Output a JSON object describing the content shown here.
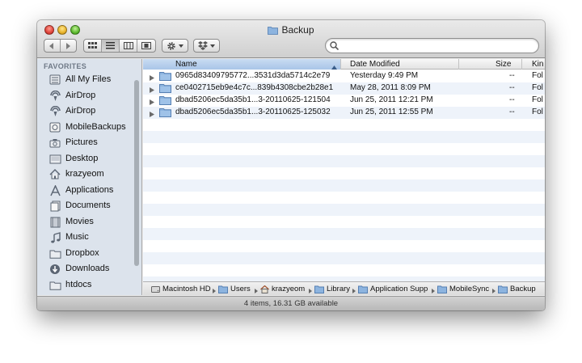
{
  "window": {
    "title": "Backup",
    "status": "4 items, 16.31 GB available"
  },
  "toolbar": {
    "back_icon": "back-arrow-icon",
    "forward_icon": "forward-arrow-icon",
    "views": [
      "icon-view",
      "list-view",
      "column-view",
      "coverflow-view"
    ],
    "active_view": "list-view",
    "action_icon": "gear-icon",
    "dropbox_icon": "dropbox-icon",
    "search": {
      "placeholder": "",
      "value": ""
    }
  },
  "sidebar": {
    "section": "FAVORITES",
    "items": [
      {
        "label": "All My Files",
        "icon": "all-files-icon"
      },
      {
        "label": "AirDrop",
        "icon": "airdrop-icon"
      },
      {
        "label": "AirDrop",
        "icon": "airdrop-icon"
      },
      {
        "label": "MobileBackups",
        "icon": "drive-icon"
      },
      {
        "label": "Pictures",
        "icon": "camera-icon"
      },
      {
        "label": "Desktop",
        "icon": "desktop-icon"
      },
      {
        "label": "krazyeom",
        "icon": "home-icon"
      },
      {
        "label": "Applications",
        "icon": "applications-icon"
      },
      {
        "label": "Documents",
        "icon": "documents-icon"
      },
      {
        "label": "Movies",
        "icon": "movies-icon"
      },
      {
        "label": "Music",
        "icon": "music-icon"
      },
      {
        "label": "Dropbox",
        "icon": "dropbox-folder-icon"
      },
      {
        "label": "Downloads",
        "icon": "downloads-icon"
      },
      {
        "label": "htdocs",
        "icon": "folder-icon"
      }
    ]
  },
  "columns": {
    "name": "Name",
    "date": "Date Modified",
    "size": "Size",
    "kind": "Kin"
  },
  "files": [
    {
      "name": "0965d83409795772...3531d3da5714c2e79",
      "date": "Yesterday 9:49 PM",
      "size": "--",
      "kind": "Fol"
    },
    {
      "name": "ce0402715eb9e4c7c...839b4308cbe2b28e1",
      "date": "May 28, 2011 8:09 PM",
      "size": "--",
      "kind": "Fol"
    },
    {
      "name": "dbad5206ec5da35b1...3-20110625-121504",
      "date": "Jun 25, 2011 12:21 PM",
      "size": "--",
      "kind": "Fol"
    },
    {
      "name": "dbad5206ec5da35b1...3-20110625-125032",
      "date": "Jun 25, 2011 12:55 PM",
      "size": "--",
      "kind": "Fol"
    }
  ],
  "pathbar": [
    "Macintosh HD",
    "Users",
    "krazyeom",
    "Library",
    "Application Supp",
    "MobileSync",
    "Backup"
  ],
  "colors": {
    "accent": "#a9c5e8",
    "sidebar": "#dce3ec",
    "row_alt": "#eef3fa",
    "folder": "#7fa9d6"
  }
}
